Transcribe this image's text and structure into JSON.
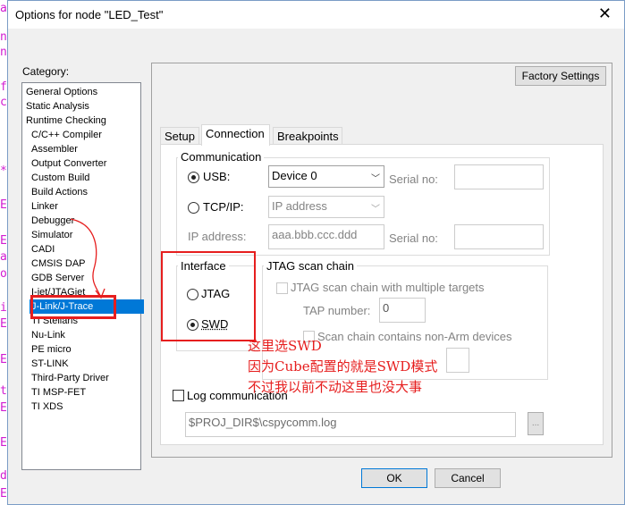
{
  "window": {
    "title": "Options for node \"LED_Test\""
  },
  "category": {
    "label": "Category:",
    "items": [
      {
        "label": "General Options",
        "sub": false,
        "selected": false
      },
      {
        "label": "Static Analysis",
        "sub": false,
        "selected": false
      },
      {
        "label": "Runtime Checking",
        "sub": false,
        "selected": false
      },
      {
        "label": "C/C++ Compiler",
        "sub": true,
        "selected": false
      },
      {
        "label": "Assembler",
        "sub": true,
        "selected": false
      },
      {
        "label": "Output Converter",
        "sub": true,
        "selected": false
      },
      {
        "label": "Custom Build",
        "sub": true,
        "selected": false
      },
      {
        "label": "Build Actions",
        "sub": true,
        "selected": false
      },
      {
        "label": "Linker",
        "sub": true,
        "selected": false
      },
      {
        "label": "Debugger",
        "sub": true,
        "selected": false
      },
      {
        "label": "Simulator",
        "sub": true,
        "selected": false
      },
      {
        "label": "CADI",
        "sub": true,
        "selected": false
      },
      {
        "label": "CMSIS DAP",
        "sub": true,
        "selected": false
      },
      {
        "label": "GDB Server",
        "sub": true,
        "selected": false
      },
      {
        "label": "I-jet/JTAGjet",
        "sub": true,
        "selected": false
      },
      {
        "label": "J-Link/J-Trace",
        "sub": true,
        "selected": true
      },
      {
        "label": "TI Stellaris",
        "sub": true,
        "selected": false
      },
      {
        "label": "Nu-Link",
        "sub": true,
        "selected": false
      },
      {
        "label": "PE micro",
        "sub": true,
        "selected": false
      },
      {
        "label": "ST-LINK",
        "sub": true,
        "selected": false
      },
      {
        "label": "Third-Party Driver",
        "sub": true,
        "selected": false
      },
      {
        "label": "TI MSP-FET",
        "sub": true,
        "selected": false
      },
      {
        "label": "TI XDS",
        "sub": true,
        "selected": false
      }
    ]
  },
  "factory_button": "Factory Settings",
  "tabs": [
    "Setup",
    "Connection",
    "Breakpoints"
  ],
  "communication": {
    "label": "Communication",
    "usb_label": "USB:",
    "usb_device": "Device 0",
    "serial_label": "Serial no:",
    "tcpip_label": "TCP/IP:",
    "tcpip_value": "IP address",
    "ip_label": "IP address:",
    "ip_placeholder": "aaa.bbb.ccc.ddd",
    "serial_label2": "Serial no:"
  },
  "interface": {
    "label": "Interface",
    "jtag_label": "JTAG",
    "swd_label": "SWD"
  },
  "jtag_chain": {
    "label": "JTAG scan chain",
    "multi_label": "JTAG scan chain with multiple targets",
    "tap_label": "TAP number:",
    "tap_value": "0",
    "nonarm_label": "Scan chain contains non-Arm devices"
  },
  "log": {
    "label": "Log communication",
    "path": "$PROJ_DIR$\\cspycomm.log",
    "browse": "..."
  },
  "buttons": {
    "ok": "OK",
    "cancel": "Cancel"
  },
  "annotation": {
    "line1": "这里选SWD",
    "line2": "因为Cube配置的就是SWD模式",
    "line3": "不过我以前不动这里也没大事"
  },
  "background_code": [
    "a",
    "n",
    "n",
    "f",
    "c",
    "*",
    "E",
    "E",
    "a",
    "o",
    "i",
    "E",
    "E",
    "t",
    "E",
    "E",
    "d",
    "E"
  ],
  "colors": {
    "annotation": "#e61e1e",
    "selection": "#0078d7",
    "code_magenta": "#d21bd2"
  }
}
